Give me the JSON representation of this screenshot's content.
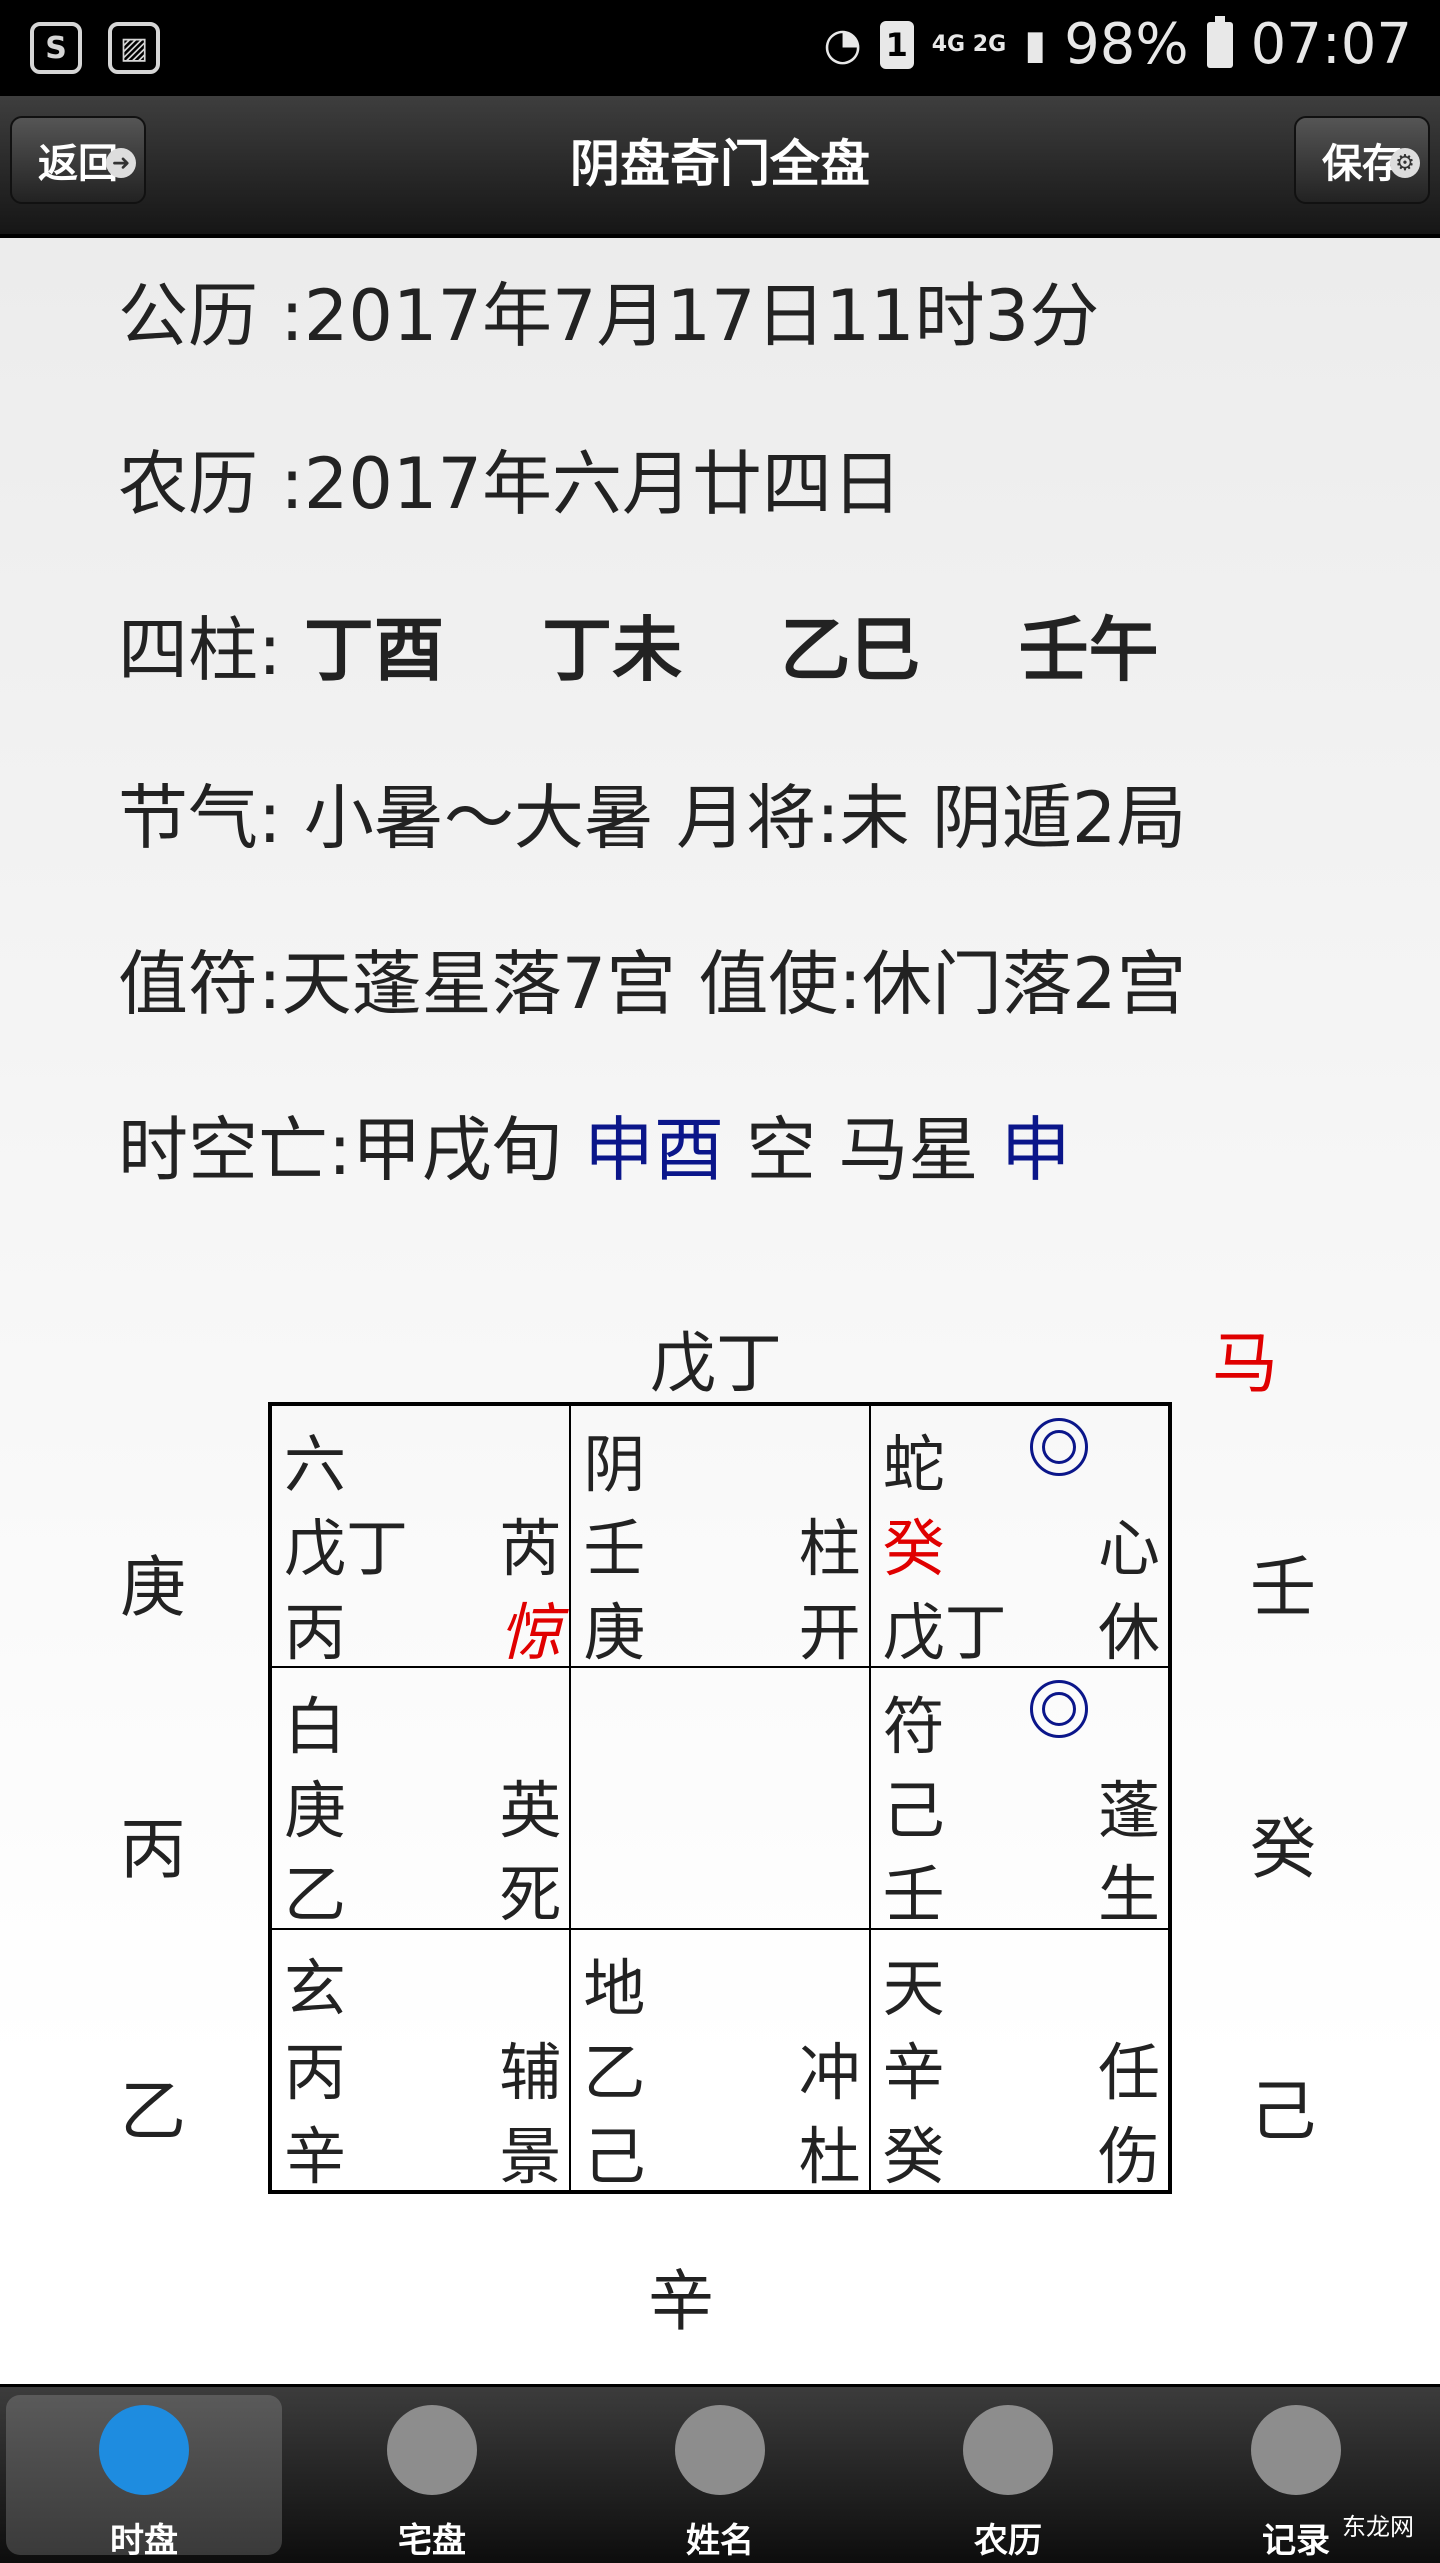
{
  "status": {
    "battery": "98%",
    "time": "07:07",
    "sim": "1",
    "net": "4G 2G"
  },
  "header": {
    "title": "阴盘奇门全盘",
    "back_label": "返回",
    "save_label": "保存"
  },
  "info": {
    "solar_label": "公历 :",
    "solar_value": "2017年7月17日11时3分",
    "lunar_label": "农历 :",
    "lunar_value": "2017年六月廿四日",
    "pillars_label": "四柱:",
    "pillars": [
      "丁酉",
      "丁未",
      "乙巳",
      "壬午"
    ],
    "solar_term": "节气: 小暑～大暑 月将:未 阴遁2局",
    "duty": "值符:天蓬星落7宫 值使:休门落2宫",
    "empty_prefix": "时空亡:甲戌旬",
    "empty_value": "申酉",
    "empty_mid": "空 马星",
    "horse_value": "申"
  },
  "plate": {
    "top_outer": "戊丁",
    "horse_mark": "马",
    "bottom_outer": "辛",
    "left_outer": [
      "庚",
      "丙",
      "乙"
    ],
    "right_outer": [
      "壬",
      "癸",
      "己"
    ],
    "cells": [
      {
        "god": "六",
        "l2": "戊丁",
        "r2": "芮",
        "l3": "丙",
        "r3": "惊"
      },
      {
        "god": "阴",
        "l2": "壬",
        "r2": "柱",
        "l3": "庚",
        "r3": "开"
      },
      {
        "god": "蛇",
        "l2": "癸",
        "r2": "心",
        "l3": "戊丁",
        "r3": "休"
      },
      {
        "god": "白",
        "l2": "庚",
        "r2": "英",
        "l3": "乙",
        "r3": "死"
      },
      {
        "god": "",
        "l2": "",
        "r2": "",
        "l3": "",
        "r3": ""
      },
      {
        "god": "符",
        "l2": "己",
        "r2": "蓬",
        "l3": "壬",
        "r3": "生"
      },
      {
        "god": "玄",
        "l2": "丙",
        "r2": "辅",
        "l3": "辛",
        "r3": "景"
      },
      {
        "god": "地",
        "l2": "乙",
        "r2": "冲",
        "l3": "己",
        "r3": "杜"
      },
      {
        "god": "天",
        "l2": "辛",
        "r2": "任",
        "l3": "癸",
        "r3": "伤"
      }
    ]
  },
  "nav": {
    "items": [
      "时盘",
      "宅盘",
      "姓名",
      "农历",
      "记录"
    ],
    "watermark": "东龙网"
  }
}
